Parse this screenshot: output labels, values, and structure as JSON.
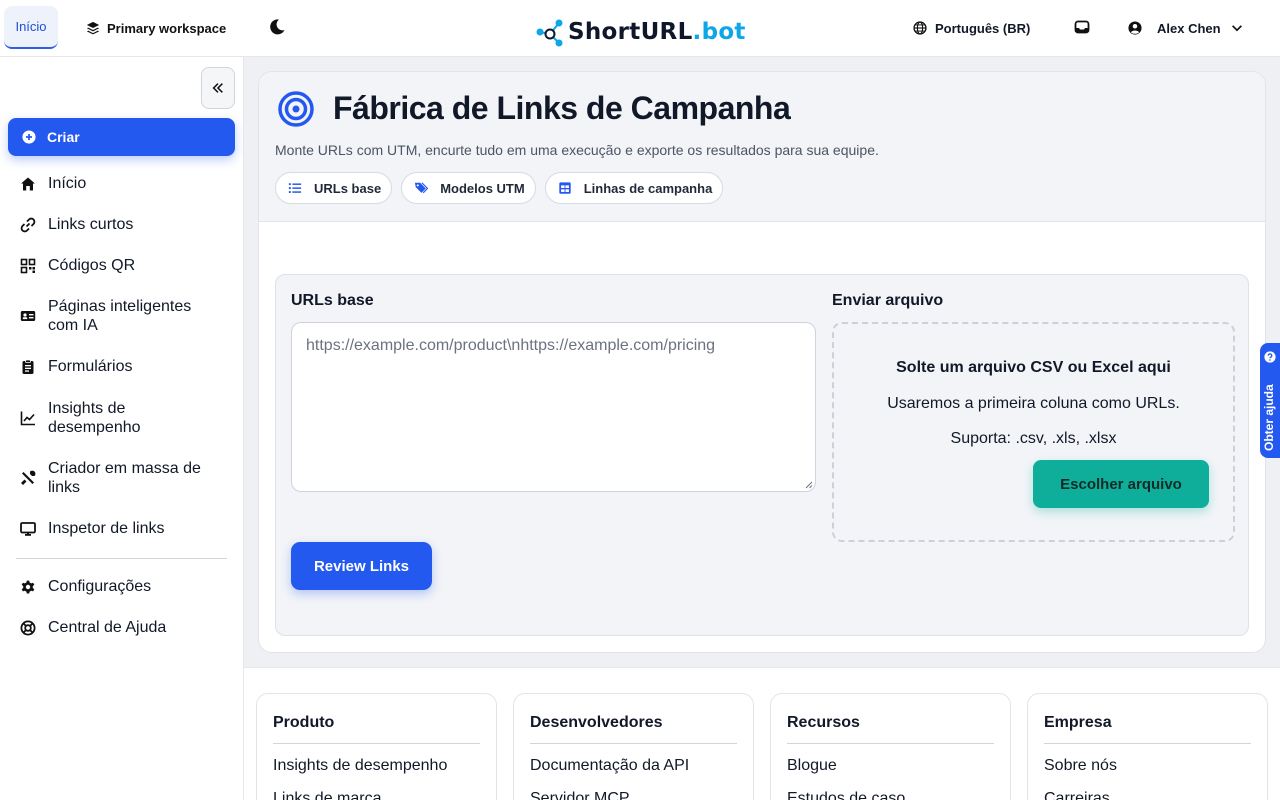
{
  "topbar": {
    "home_tab": "Início",
    "workspace": "Primary workspace",
    "logo": {
      "main": "ShortURL",
      "suffix": ".bot"
    },
    "language": "Português (BR)",
    "user_name": "Alex Chen"
  },
  "sidebar": {
    "create_label": "Criar",
    "items": [
      {
        "label": "Início",
        "icon": "home-icon"
      },
      {
        "label": "Links curtos",
        "icon": "link-icon"
      },
      {
        "label": "Códigos QR",
        "icon": "qr-icon"
      },
      {
        "label": "Páginas inteligentes com IA",
        "icon": "id-card-icon"
      },
      {
        "label": "Formulários",
        "icon": "clipboard-icon"
      },
      {
        "label": "Insights de desempenho",
        "icon": "chart-line-icon"
      },
      {
        "label": "Criador em massa de links",
        "icon": "tools-icon"
      },
      {
        "label": "Inspetor de links",
        "icon": "monitor-icon"
      }
    ],
    "bottom_items": [
      {
        "label": "Configurações",
        "icon": "gear-icon"
      },
      {
        "label": "Central de Ajuda",
        "icon": "lifebuoy-icon"
      }
    ]
  },
  "page": {
    "title": "Fábrica de Links de Campanha",
    "subtitle": "Monte URLs com UTM, encurte tudo em uma execução e exporte os resultados para sua equipe.",
    "pills": [
      {
        "label": "URLs base",
        "icon": "list-icon"
      },
      {
        "label": "Modelos UTM",
        "icon": "tags-icon"
      },
      {
        "label": "Linhas de campanha",
        "icon": "table-icon"
      }
    ]
  },
  "form": {
    "base_urls_label": "URLs base",
    "base_urls_placeholder": "https://example.com/product\\nhttps://example.com/pricing",
    "upload_label": "Enviar arquivo",
    "drop_title": "Solte um arquivo CSV ou Excel aqui",
    "drop_hint": "Usaremos a primeira coluna como URLs.",
    "drop_formats": "Suporta: .csv, .xls, .xlsx",
    "choose_file": "Escolher arquivo",
    "review_button": "Review Links"
  },
  "help_tab": "Obter ajuda",
  "footer": {
    "columns": [
      {
        "title": "Produto",
        "links": [
          "Insights de desempenho",
          "Links de marca"
        ]
      },
      {
        "title": "Desenvolvedores",
        "links": [
          "Documentação da API",
          "Servidor MCP"
        ]
      },
      {
        "title": "Recursos",
        "links": [
          "Blogue",
          "Estudos de caso"
        ]
      },
      {
        "title": "Empresa",
        "links": [
          "Sobre nós",
          "Carreiras"
        ]
      }
    ]
  },
  "colors": {
    "primary": "#2459f0",
    "teal": "#0eae9b",
    "logo_accent": "#0ea5e9"
  }
}
